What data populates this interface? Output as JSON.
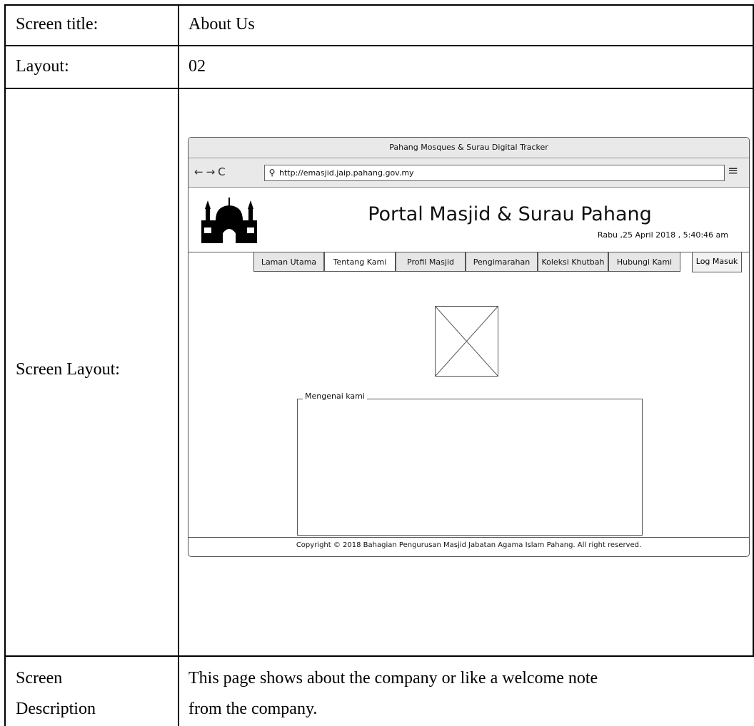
{
  "document": {
    "rows": [
      {
        "label": "Screen title:",
        "value": "About Us"
      },
      {
        "label": "Layout:",
        "value": "02"
      },
      {
        "label": "Screen Layout:"
      },
      {
        "label_line1": "Screen",
        "label_line2": "Description",
        "value_line1": "This page shows about the company or like a welcome note",
        "value_line2": "from the company."
      }
    ]
  },
  "mockup": {
    "window_title": "Pahang Mosques & Surau Digital Tracker",
    "url": "http://emasjid.jaip.pahang.gov.my",
    "portal_title": "Portal Masjid & Surau Pahang",
    "datetime": "Rabu ,25 April 2018 , 5:40:46 am",
    "tabs": [
      {
        "label": "Laman Utama"
      },
      {
        "label": "Tentang Kami"
      },
      {
        "label": "Profil Masjid"
      },
      {
        "label": "Pengimarahan"
      },
      {
        "label": "Koleksi Khutbah"
      },
      {
        "label": "Hubungi Kami"
      }
    ],
    "login_label": "Log Masuk",
    "fieldset_legend": "Mengenai kami",
    "footer": "Copyright © 2018 Bahagian Pengurusan Masjid Jabatan Agama Islam Pahang. All right reserved.",
    "icons": {
      "back": "arrow-left-icon",
      "forward": "arrow-right-icon",
      "reload": "reload-icon",
      "search": "search-icon",
      "menu": "hamburger-menu-icon",
      "logo": "mosque-logo-icon",
      "image": "image-placeholder-icon"
    }
  }
}
